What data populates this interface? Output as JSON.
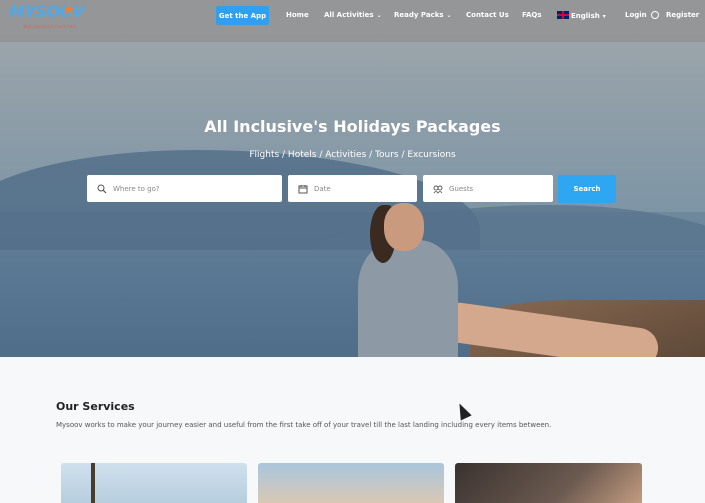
{
  "navbar": {
    "logo_text": "MYSOOV",
    "logo_tagline": "Your adventure starts here",
    "app_button": "Get the App",
    "items": [
      {
        "label": "Home"
      },
      {
        "label": "All Activities"
      },
      {
        "label": "Ready Packs"
      },
      {
        "label": "Contact Us"
      },
      {
        "label": "FAQs"
      }
    ],
    "language": "English",
    "login": "Login",
    "register": "Register"
  },
  "hero": {
    "title": "All Inclusive's Holidays Packages",
    "subtitle": "Flights / Hotels / Activities / Tours / Excursions"
  },
  "search": {
    "where_placeholder": "Where to go?",
    "date_placeholder": "Date",
    "guests_placeholder": "Guests",
    "button": "Search"
  },
  "services": {
    "title": "Our Services",
    "description": "Mysoov works to make your journey easier and useful from the first take off of your travel till the last landing including every items between."
  },
  "colors": {
    "accent": "#2fa6f2",
    "navbar": "#969696",
    "logo": "#4fa8e8"
  },
  "icons": {
    "search": "search-icon",
    "date": "calendar-icon",
    "guests": "guests-icon",
    "user": "user-icon",
    "flag": "uk-flag-icon"
  }
}
